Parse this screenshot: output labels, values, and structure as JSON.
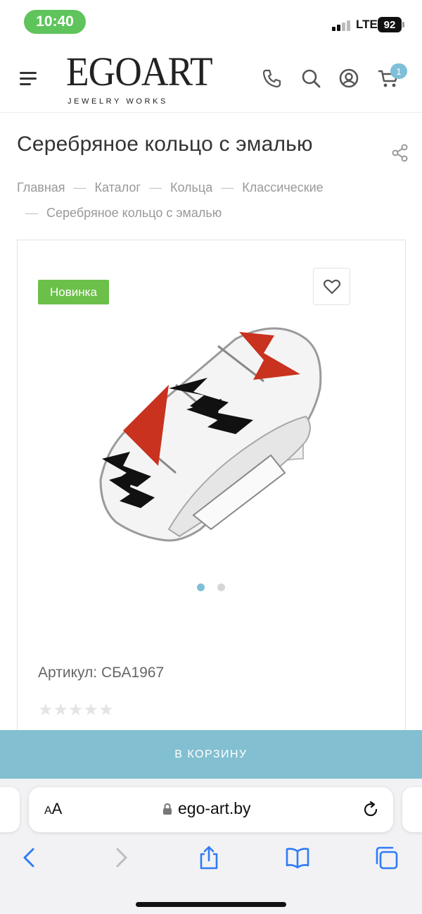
{
  "status_bar": {
    "time": "10:40",
    "network": "LTE",
    "battery": "92"
  },
  "header": {
    "logo_main": "EGOART",
    "logo_sub": "JEWELRY WORKS",
    "cart_count": "1",
    "icons": [
      "menu-icon",
      "phone-icon",
      "search-icon",
      "account-icon",
      "cart-icon"
    ]
  },
  "page": {
    "title": "Серебряное кольцо с эмалью"
  },
  "breadcrumb": {
    "items": [
      "Главная",
      "Каталог",
      "Кольца",
      "Классические",
      "Серебряное кольцо с эмалью"
    ],
    "separator": "—"
  },
  "product": {
    "badge": "Новинка",
    "sku_label": "Артикул: СБА1967",
    "rating_stars": "★★★★★",
    "rating_value": 0,
    "gallery_slides": 2,
    "active_slide": 1
  },
  "actions": {
    "add_to_cart": "В КОРЗИНУ"
  },
  "browser": {
    "aa_label_small": "A",
    "aa_label_large": "A",
    "url": "ego-art.by",
    "toolbar_icons": [
      "back-icon",
      "forward-icon",
      "share-icon",
      "bookmarks-icon",
      "tabs-icon"
    ]
  },
  "colors": {
    "accent": "#82bfd1",
    "badge_green": "#6cc04a",
    "enamel_red": "#c8321e",
    "time_pill": "#5ec45b"
  }
}
